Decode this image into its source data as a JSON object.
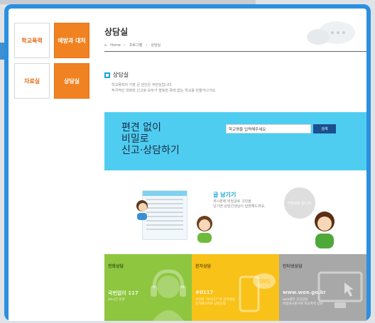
{
  "menu": {
    "items": [
      {
        "label": "학교폭력",
        "style": "white"
      },
      {
        "label": "예방과 대처",
        "style": "orange"
      },
      {
        "label": "자료실",
        "style": "white"
      },
      {
        "label": "상담실",
        "style": "orange"
      }
    ]
  },
  "header": {
    "title": "상담실",
    "breadcrumb": [
      "Home",
      "프로그램",
      "상담실"
    ]
  },
  "section": {
    "title": "상담실",
    "desc_line1": "학교폭력의 가장 큰 원인은 무관심입니다.",
    "desc_line2": "적극적인 대화와 신고로 모두가 행복한 폭력 없는 학교를 만들어나가요."
  },
  "banner": {
    "slogan": [
      "편견 없이",
      "비밀로",
      "신고·상담하기"
    ],
    "search_placeholder": "학교명을 입력해주세요",
    "search_button": "검색"
  },
  "illustration": {
    "write_title": "글 남기기",
    "write_desc_line1": "게시판에 비밀글로 고민을",
    "write_desc_line2": "남기면 상담선생님이 답변해드려요.",
    "bubble_text": "익명보장 됩니다."
  },
  "panels": [
    {
      "title": "전화상담",
      "value": "국번없이 117",
      "sub1": "24시간 운영",
      "sub2": ""
    },
    {
      "title": "문자상담",
      "value": "#0117",
      "sub1": "수신번 “#0117”로 문자발송",
      "sub2": "문자메시지로 상담진행"
    },
    {
      "title": "인터넷상담",
      "value": "www.wee.go.kr",
      "sub1": "wee센터 고민상담",
      "sub2": "비밀게시판으로 학교폭력 상담"
    }
  ],
  "colors": {
    "frame": "#2b90e0",
    "orange": "#f08221",
    "banner": "#4fcdf0",
    "phone_panel": "#8ec63f",
    "text_panel": "#f9c218",
    "web_panel": "#a8a8a8"
  }
}
